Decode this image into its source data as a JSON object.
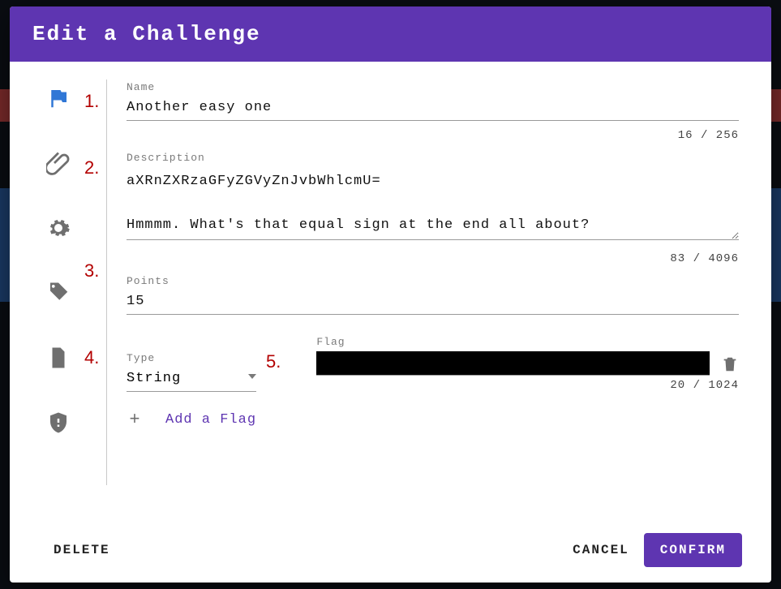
{
  "header": {
    "title": "Edit a Challenge"
  },
  "annotations": {
    "a1": "1.",
    "a2": "2.",
    "a3": "3.",
    "a4": "4.",
    "a5": "5."
  },
  "fields": {
    "name": {
      "label": "Name",
      "value": "Another easy one",
      "counter": "16 / 256"
    },
    "description": {
      "label": "Description",
      "value": "aXRnZXRzaGFyZGVyZnJvbWhlcmU=\n\nHmmmm. What's that equal sign at the end all about?",
      "counter": "83 / 4096"
    },
    "points": {
      "label": "Points",
      "value": "15"
    },
    "type": {
      "label": "Type",
      "selected": "String"
    },
    "flag": {
      "label": "Flag",
      "counter": "20 / 1024"
    }
  },
  "addFlag": {
    "label": "Add a Flag"
  },
  "footer": {
    "delete": "DELETE",
    "cancel": "CANCEL",
    "confirm": "CONFIRM"
  }
}
